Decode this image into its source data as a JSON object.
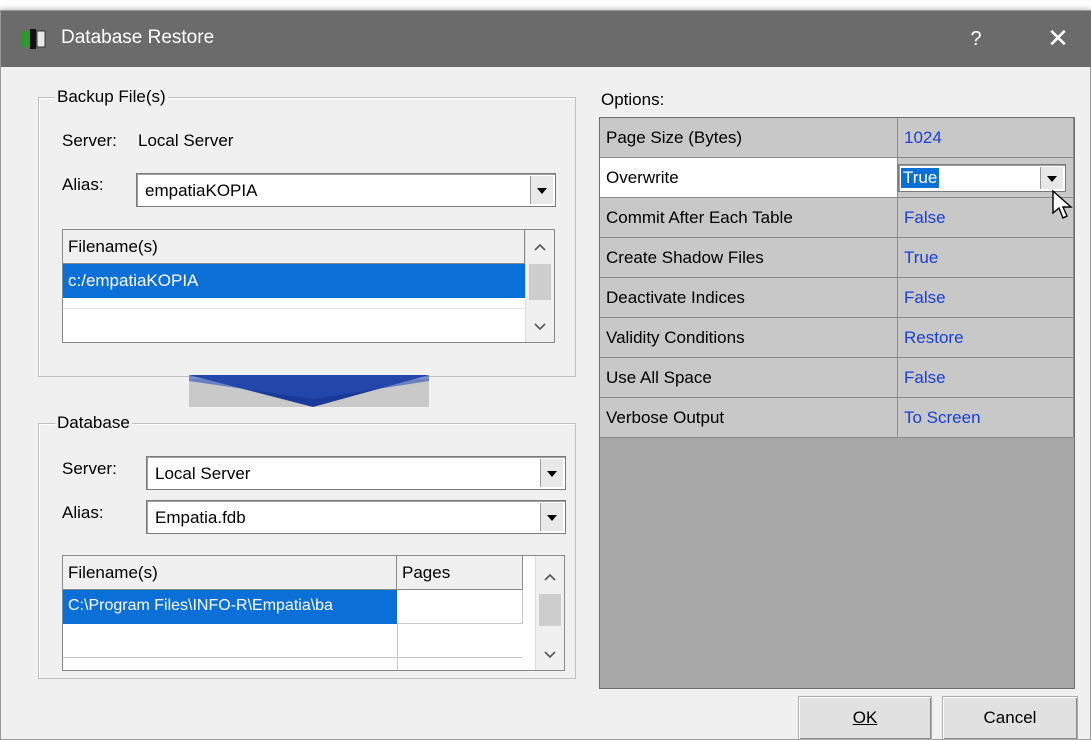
{
  "window": {
    "title": "Database Restore",
    "help_label": "?",
    "close_label": "✕"
  },
  "backup": {
    "group_label": "Backup File(s)",
    "server_label": "Server:",
    "server_value": "Local Server",
    "alias_label": "Alias:",
    "alias_value": "empatiaKOPIA",
    "list_header": "Filename(s)",
    "files": [
      "c:/empatiaKOPIA"
    ]
  },
  "database": {
    "group_label": "Database",
    "server_label": "Server:",
    "server_value": "Local Server",
    "alias_label": "Alias:",
    "alias_value": "Empatia.fdb",
    "col_filename": "Filename(s)",
    "col_pages": "Pages",
    "files": [
      {
        "filename": "C:\\Program Files\\INFO-R\\Empatia\\ba",
        "pages": ""
      }
    ]
  },
  "options": {
    "label": "Options:",
    "rows": [
      {
        "name": "Page Size (Bytes)",
        "value": "1024"
      },
      {
        "name": "Overwrite",
        "value": "True"
      },
      {
        "name": "Commit After Each Table",
        "value": "False"
      },
      {
        "name": "Create Shadow Files",
        "value": "True"
      },
      {
        "name": "Deactivate Indices",
        "value": "False"
      },
      {
        "name": "Validity Conditions",
        "value": "Restore"
      },
      {
        "name": "Use All Space",
        "value": "False"
      },
      {
        "name": "Verbose Output",
        "value": "To Screen"
      }
    ]
  },
  "buttons": {
    "ok": "OK",
    "cancel": "Cancel"
  },
  "colors": {
    "selection": "#0a6fd6",
    "value_text": "#1a3fd8",
    "arrow": "#1a3a9a",
    "titlebar": "#6b6b6b"
  }
}
